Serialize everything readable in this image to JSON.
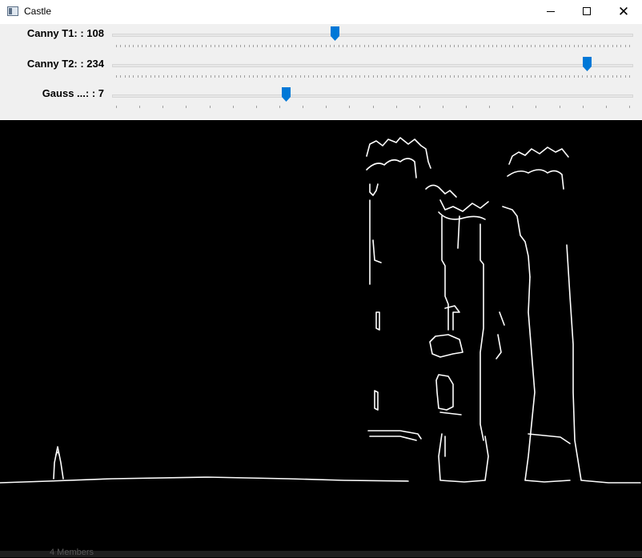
{
  "window": {
    "title": "Castle",
    "icon": "app-window-icon"
  },
  "sliders": [
    {
      "label": "Canny T1: : 108",
      "value": 108,
      "fraction": 0.426
    },
    {
      "label": "Canny T2: : 234",
      "value": 234,
      "fraction": 0.917
    },
    {
      "label": "Gauss ...: : 7",
      "value": 7,
      "fraction": 0.33
    }
  ],
  "canvas": {
    "background": "#000000",
    "edge_color": "#ffffff"
  },
  "taskbar_peek": {
    "text": "4 Members"
  }
}
